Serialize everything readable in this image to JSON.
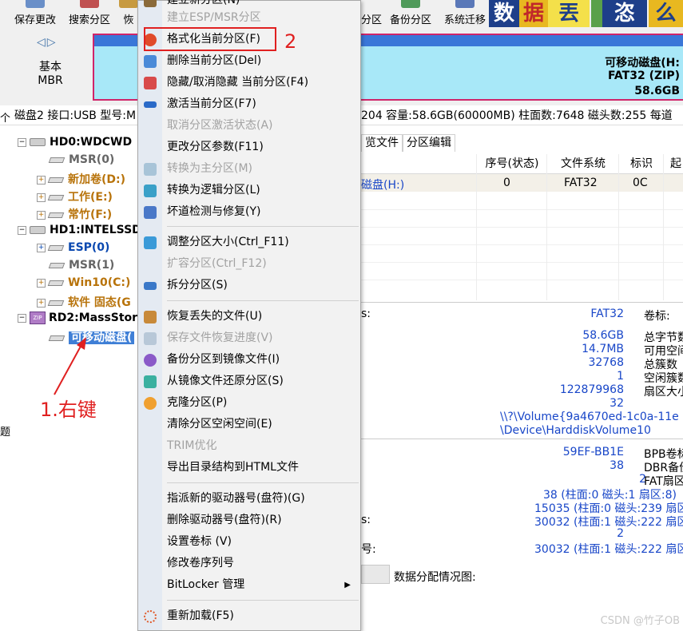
{
  "toolbar": {
    "buttons": [
      {
        "label": "保存更改",
        "icon": "save-icon"
      },
      {
        "label": "搜索分区",
        "icon": "search-icon"
      },
      {
        "label": "恢",
        "icon": "recover-icon"
      },
      {
        "label": "分区",
        "icon": "partition-icon"
      },
      {
        "label": "备份分区",
        "icon": "backup-icon"
      },
      {
        "label": "系统迁移",
        "icon": "migrate-icon"
      }
    ],
    "tiles": [
      "数",
      "据",
      "丟",
      "恣",
      "么"
    ]
  },
  "disk_view": {
    "nav_arrows": "◁▷",
    "style_line1": "基本",
    "style_line2": "MBR",
    "partition_name": "可移动磁盘(H:",
    "partition_fs": "FAT32 (ZIP)",
    "partition_size": "58.6GB"
  },
  "info_line": {
    "left": "磁盘2 接口:USB  型号:M",
    "right": "204  容量:58.6GB(60000MB)  柱面数:7648  磁头数:255  每道"
  },
  "left_edge": {
    "top": "个",
    "mid": "题"
  },
  "tree": {
    "disks": [
      {
        "label": "HD0:WDCWD",
        "children": [
          {
            "label": "MSR(0)",
            "color": "gray"
          },
          {
            "label": "新加卷(D:)",
            "color": "orange"
          },
          {
            "label": "工作(E:)",
            "color": "orange"
          },
          {
            "label": "常竹(F:)",
            "color": "orange"
          }
        ]
      },
      {
        "label": "HD1:INTELSSD",
        "children": [
          {
            "label": "ESP(0)",
            "color": "blue"
          },
          {
            "label": "MSR(1)",
            "color": "gray"
          },
          {
            "label": "Win10(C:)",
            "color": "orange"
          },
          {
            "label": "软件 固态(G",
            "color": "orange"
          }
        ]
      },
      {
        "label": "RD2:MassStor",
        "children": [
          {
            "label": "可移动磁盘(",
            "color": "selected"
          }
        ]
      }
    ]
  },
  "right_panel": {
    "tabs": [
      "览文件",
      "分区编辑"
    ],
    "columns": [
      "序号(状态)",
      "文件系统",
      "标识",
      "起"
    ],
    "row": {
      "name": "磁盘(H:)",
      "index": "0",
      "fs": "FAT32",
      "id": "0C"
    },
    "details_block1": [
      {
        "value": "FAT32",
        "label": "卷标:"
      },
      {
        "value": "58.6GB",
        "label": "总字节数"
      },
      {
        "value": "14.7MB",
        "label": "可用空间"
      },
      {
        "value": "32768",
        "label": "总簇数"
      },
      {
        "value": "1",
        "label": "空闲簇数"
      },
      {
        "value": "122879968",
        "label": "扇区大小"
      },
      {
        "value": "32",
        "label": ""
      },
      {
        "value": "\\\\?\\Volume{9a4670ed-1c0a-11e",
        "label": ""
      },
      {
        "value": "\\Device\\HarddiskVolume10",
        "label": ""
      }
    ],
    "details_block2": [
      {
        "value": "59EF-BB1E",
        "label": "BPB卷标"
      },
      {
        "value": "38",
        "label": "DBR备份"
      },
      {
        "value": "2",
        "label": "FAT扇区"
      },
      {
        "value": "38 (柱面:0 磁头:1 扇区:8)",
        "label": ""
      },
      {
        "value": "15035 (柱面:0 磁头:239 扇区",
        "label": ""
      },
      {
        "value": "30032 (柱面:1 磁头:222 扇区",
        "label": ""
      },
      {
        "value": "2",
        "label": ""
      },
      {
        "value": "30032 (柱面:1 磁头:222 扇区",
        "label": ""
      }
    ],
    "colon_labels": [
      "s:",
      "s:",
      "号:"
    ],
    "distribution_label": "数据分配情况图:"
  },
  "context_menu": {
    "items": [
      {
        "label": "建立新分区(N)",
        "enabled": true,
        "icon": "new-partition-icon"
      },
      {
        "label": "建立ESP/MSR分区",
        "enabled": false,
        "icon": ""
      },
      {
        "label": "格式化当前分区(F)",
        "enabled": true,
        "icon": "format-icon"
      },
      {
        "label": "删除当前分区(Del)",
        "enabled": true,
        "icon": "delete-icon"
      },
      {
        "label": "隐藏/取消隐藏 当前分区(F4)",
        "enabled": true,
        "icon": "hide-icon"
      },
      {
        "label": "激活当前分区(F7)",
        "enabled": true,
        "icon": "activate-icon"
      },
      {
        "label": "取消分区激活状态(A)",
        "enabled": false,
        "icon": ""
      },
      {
        "label": "更改分区参数(F11)",
        "enabled": true,
        "icon": ""
      },
      {
        "label": "转换为主分区(M)",
        "enabled": false,
        "icon": "convert-primary-icon"
      },
      {
        "label": "转换为逻辑分区(L)",
        "enabled": true,
        "icon": "convert-logical-icon"
      },
      {
        "label": "坏道检测与修复(Y)",
        "enabled": true,
        "icon": "repair-icon"
      },
      {
        "label": "调整分区大小(Ctrl_F11)",
        "enabled": true,
        "icon": "resize-icon"
      },
      {
        "label": "扩容分区(Ctrl_F12)",
        "enabled": false,
        "icon": ""
      },
      {
        "label": "拆分分区(S)",
        "enabled": true,
        "icon": "split-icon"
      },
      {
        "label": "恢复丢失的文件(U)",
        "enabled": true,
        "icon": "restore-files-icon"
      },
      {
        "label": "保存文件恢复进度(V)",
        "enabled": false,
        "icon": "save-progress-icon"
      },
      {
        "label": "备份分区到镜像文件(I)",
        "enabled": true,
        "icon": "backup-image-icon"
      },
      {
        "label": "从镜像文件还原分区(S)",
        "enabled": true,
        "icon": "restore-image-icon"
      },
      {
        "label": "克隆分区(P)",
        "enabled": true,
        "icon": "clone-icon"
      },
      {
        "label": "清除分区空闲空间(E)",
        "enabled": true,
        "icon": ""
      },
      {
        "label": "TRIM优化",
        "enabled": false,
        "icon": ""
      },
      {
        "label": "导出目录结构到HTML文件",
        "enabled": true,
        "icon": ""
      },
      {
        "label": "指派新的驱动器号(盘符)(G)",
        "enabled": true,
        "icon": ""
      },
      {
        "label": "删除驱动器号(盘符)(R)",
        "enabled": true,
        "icon": ""
      },
      {
        "label": "设置卷标 (V)",
        "enabled": true,
        "icon": ""
      },
      {
        "label": "修改卷序列号",
        "enabled": true,
        "icon": ""
      },
      {
        "label": "BitLocker 管理",
        "enabled": true,
        "icon": ""
      },
      {
        "label": "重新加载(F5)",
        "enabled": true,
        "icon": "reload-icon"
      }
    ]
  },
  "annotations": {
    "step1": "1.右键",
    "step2": "2"
  },
  "watermark": "CSDN @竹子OB",
  "colors": {
    "accent": "#3f7fd6",
    "annotation": "#e02020",
    "partition_fill": "#a8e8f8",
    "partition_border": "#d0256a"
  }
}
